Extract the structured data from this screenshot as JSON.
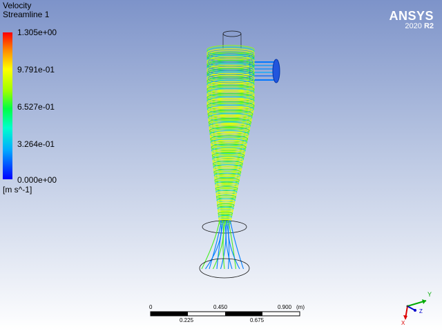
{
  "legend": {
    "variable": "Velocity",
    "object": "Streamline 1",
    "max_label": "1.305e+00",
    "l3_label": "9.791e-01",
    "mid_label": "6.527e-01",
    "l1_label": "3.264e-01",
    "min_label": "0.000e+00",
    "unit": "[m s^-1]"
  },
  "brand": {
    "name": "ANSYS",
    "version": "2020",
    "release": "R2"
  },
  "scale": {
    "top_labels": [
      "0",
      "0.450",
      "0.900"
    ],
    "unit": "(m)",
    "bottom_labels": [
      "0.225",
      "0.675"
    ]
  },
  "triad": {
    "x": "X",
    "y": "Y",
    "z": "Z"
  },
  "colors": {
    "bg_top": "#7d93c9",
    "bg_bottom": "#ffffff",
    "stream_yellow": "#dfff00",
    "stream_green": "#44ee22",
    "stream_blue": "#0080ff"
  }
}
